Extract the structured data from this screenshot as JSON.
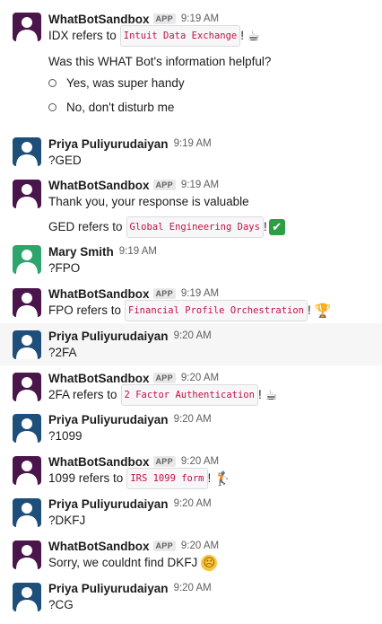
{
  "colors": {
    "bot_avatar": "#4a154b",
    "priya_avatar": "#1d4f7a",
    "mary_avatar": "#2fa56e",
    "code_text": "#c01343"
  },
  "messages": [
    {
      "author": "WhatBotSandbox",
      "badge": "APP",
      "time": "9:19 AM",
      "avatar": "bot",
      "text_before": "IDX refers to",
      "code": "Intuit Data Exchange",
      "text_after": "!",
      "emoji": "☕",
      "poll_question": "Was this WHAT Bot's information helpful?",
      "options": [
        "Yes, was super handy",
        "No, don't disturb me"
      ]
    },
    {
      "author": "Priya Puliyurudaiyan",
      "time": "9:19 AM",
      "avatar": "priya",
      "text": "?GED"
    },
    {
      "author": "WhatBotSandbox",
      "badge": "APP",
      "time": "9:19 AM",
      "avatar": "bot",
      "text": "Thank you, your response is valuable",
      "text_before": "GED refers to",
      "code": "Global Engineering Days",
      "text_after": "!",
      "emoji": "✔"
    },
    {
      "author": "Mary Smith",
      "time": "9:19 AM",
      "avatar": "mary",
      "text": "?FPO"
    },
    {
      "author": "WhatBotSandbox",
      "badge": "APP",
      "time": "9:19 AM",
      "avatar": "bot",
      "text_before": "FPO refers to",
      "code": "Financial Profile Orchestration",
      "text_after": "!",
      "emoji": "🏆"
    },
    {
      "author": "Priya Puliyurudaiyan",
      "time": "9:20 AM",
      "avatar": "priya",
      "text": "?2FA"
    },
    {
      "author": "WhatBotSandbox",
      "badge": "APP",
      "time": "9:20 AM",
      "avatar": "bot",
      "text_before": "2FA refers to",
      "code": "2 Factor Authentication",
      "text_after": "!",
      "emoji": "☕"
    },
    {
      "author": "Priya Puliyurudaiyan",
      "time": "9:20 AM",
      "avatar": "priya",
      "text": "?1099"
    },
    {
      "author": "WhatBotSandbox",
      "badge": "APP",
      "time": "9:20 AM",
      "avatar": "bot",
      "text_before": "1099 refers to",
      "code": "IRS 1099 form",
      "text_after": "!",
      "emoji": "🏌"
    },
    {
      "author": "Priya Puliyurudaiyan",
      "time": "9:20 AM",
      "avatar": "priya",
      "text": "?DKFJ"
    },
    {
      "author": "WhatBotSandbox",
      "badge": "APP",
      "time": "9:20 AM",
      "avatar": "bot",
      "text": "Sorry, we couldnt find DKFJ",
      "emoji": "☹"
    },
    {
      "author": "Priya Puliyurudaiyan",
      "time": "9:20 AM",
      "avatar": "priya",
      "text": "?CG"
    }
  ]
}
